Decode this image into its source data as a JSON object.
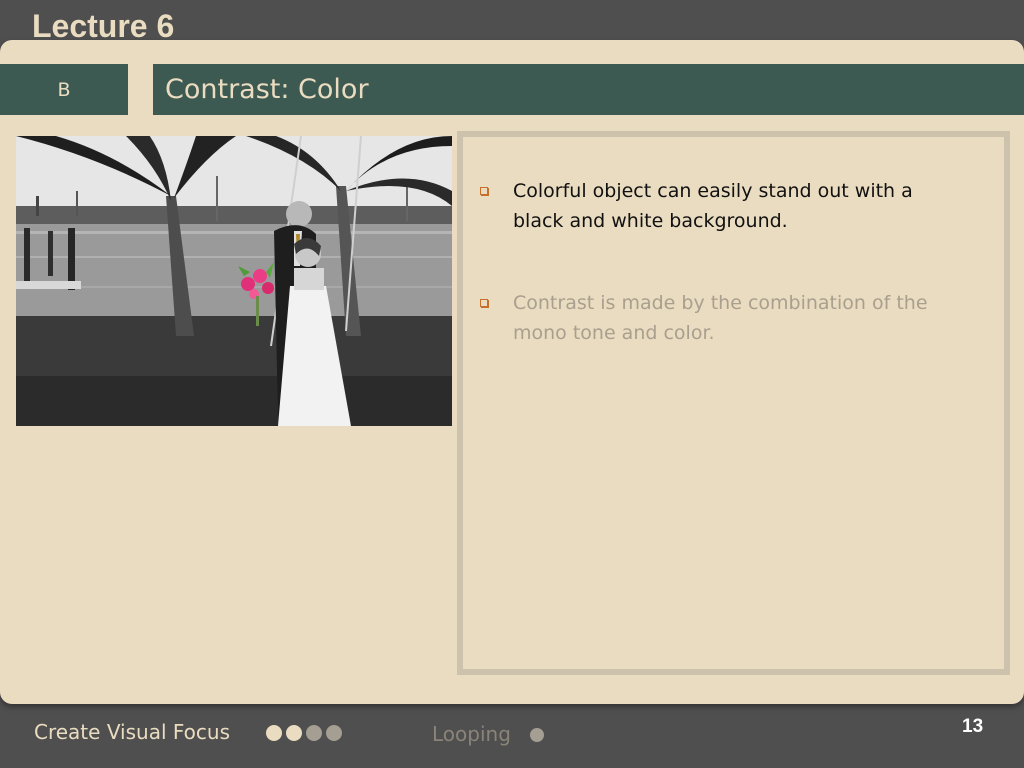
{
  "header": {
    "lecture": "Lecture 6"
  },
  "slide": {
    "section": "B",
    "title": "Contrast: Color",
    "bullets": [
      "Colorful object can easily stand out with a black and white background.",
      "Contrast is made by the combination of the mono tone and color."
    ]
  },
  "footer": {
    "topic": "Create Visual Focus",
    "next_topic": "Looping",
    "page_number": "13",
    "progress_dots": {
      "filled": 2,
      "total": 4
    }
  },
  "colors": {
    "accent": "#3d5a52",
    "background": "#eadcc0",
    "bullet": "#c96d2a"
  },
  "icons": {
    "bullet": "square-bullet-icon",
    "progress": "progress-dots-icon"
  }
}
